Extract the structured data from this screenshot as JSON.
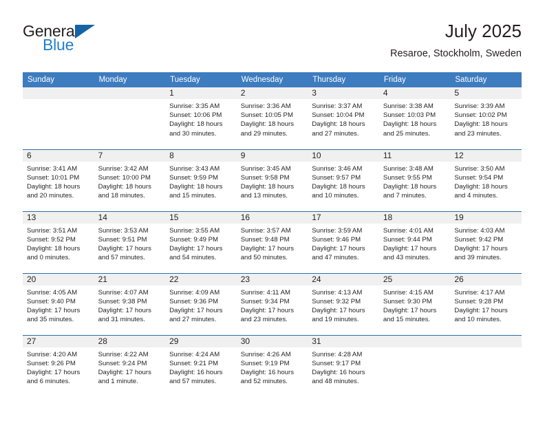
{
  "brand": {
    "name_part1": "General",
    "name_part2": "Blue",
    "logo_icon": "triangle-flag-icon"
  },
  "header": {
    "title": "July 2025",
    "location": "Resaroe, Stockholm, Sweden"
  },
  "colors": {
    "header_blue": "#3d7cbf",
    "separator_blue": "#2e6ca4",
    "daynum_band": "#f0f0f0",
    "brand_blue": "#1f7fd0",
    "logo_blue": "#1464a5",
    "text": "#231f20"
  },
  "weekday_headers": [
    "Sunday",
    "Monday",
    "Tuesday",
    "Wednesday",
    "Thursday",
    "Friday",
    "Saturday"
  ],
  "weeks": [
    [
      {
        "day": "",
        "sunrise": "",
        "sunset": "",
        "daylight1": "",
        "daylight2": ""
      },
      {
        "day": "",
        "sunrise": "",
        "sunset": "",
        "daylight1": "",
        "daylight2": ""
      },
      {
        "day": "1",
        "sunrise": "Sunrise: 3:35 AM",
        "sunset": "Sunset: 10:06 PM",
        "daylight1": "Daylight: 18 hours",
        "daylight2": "and 30 minutes."
      },
      {
        "day": "2",
        "sunrise": "Sunrise: 3:36 AM",
        "sunset": "Sunset: 10:05 PM",
        "daylight1": "Daylight: 18 hours",
        "daylight2": "and 29 minutes."
      },
      {
        "day": "3",
        "sunrise": "Sunrise: 3:37 AM",
        "sunset": "Sunset: 10:04 PM",
        "daylight1": "Daylight: 18 hours",
        "daylight2": "and 27 minutes."
      },
      {
        "day": "4",
        "sunrise": "Sunrise: 3:38 AM",
        "sunset": "Sunset: 10:03 PM",
        "daylight1": "Daylight: 18 hours",
        "daylight2": "and 25 minutes."
      },
      {
        "day": "5",
        "sunrise": "Sunrise: 3:39 AM",
        "sunset": "Sunset: 10:02 PM",
        "daylight1": "Daylight: 18 hours",
        "daylight2": "and 23 minutes."
      }
    ],
    [
      {
        "day": "6",
        "sunrise": "Sunrise: 3:41 AM",
        "sunset": "Sunset: 10:01 PM",
        "daylight1": "Daylight: 18 hours",
        "daylight2": "and 20 minutes."
      },
      {
        "day": "7",
        "sunrise": "Sunrise: 3:42 AM",
        "sunset": "Sunset: 10:00 PM",
        "daylight1": "Daylight: 18 hours",
        "daylight2": "and 18 minutes."
      },
      {
        "day": "8",
        "sunrise": "Sunrise: 3:43 AM",
        "sunset": "Sunset: 9:59 PM",
        "daylight1": "Daylight: 18 hours",
        "daylight2": "and 15 minutes."
      },
      {
        "day": "9",
        "sunrise": "Sunrise: 3:45 AM",
        "sunset": "Sunset: 9:58 PM",
        "daylight1": "Daylight: 18 hours",
        "daylight2": "and 13 minutes."
      },
      {
        "day": "10",
        "sunrise": "Sunrise: 3:46 AM",
        "sunset": "Sunset: 9:57 PM",
        "daylight1": "Daylight: 18 hours",
        "daylight2": "and 10 minutes."
      },
      {
        "day": "11",
        "sunrise": "Sunrise: 3:48 AM",
        "sunset": "Sunset: 9:55 PM",
        "daylight1": "Daylight: 18 hours",
        "daylight2": "and 7 minutes."
      },
      {
        "day": "12",
        "sunrise": "Sunrise: 3:50 AM",
        "sunset": "Sunset: 9:54 PM",
        "daylight1": "Daylight: 18 hours",
        "daylight2": "and 4 minutes."
      }
    ],
    [
      {
        "day": "13",
        "sunrise": "Sunrise: 3:51 AM",
        "sunset": "Sunset: 9:52 PM",
        "daylight1": "Daylight: 18 hours",
        "daylight2": "and 0 minutes."
      },
      {
        "day": "14",
        "sunrise": "Sunrise: 3:53 AM",
        "sunset": "Sunset: 9:51 PM",
        "daylight1": "Daylight: 17 hours",
        "daylight2": "and 57 minutes."
      },
      {
        "day": "15",
        "sunrise": "Sunrise: 3:55 AM",
        "sunset": "Sunset: 9:49 PM",
        "daylight1": "Daylight: 17 hours",
        "daylight2": "and 54 minutes."
      },
      {
        "day": "16",
        "sunrise": "Sunrise: 3:57 AM",
        "sunset": "Sunset: 9:48 PM",
        "daylight1": "Daylight: 17 hours",
        "daylight2": "and 50 minutes."
      },
      {
        "day": "17",
        "sunrise": "Sunrise: 3:59 AM",
        "sunset": "Sunset: 9:46 PM",
        "daylight1": "Daylight: 17 hours",
        "daylight2": "and 47 minutes."
      },
      {
        "day": "18",
        "sunrise": "Sunrise: 4:01 AM",
        "sunset": "Sunset: 9:44 PM",
        "daylight1": "Daylight: 17 hours",
        "daylight2": "and 43 minutes."
      },
      {
        "day": "19",
        "sunrise": "Sunrise: 4:03 AM",
        "sunset": "Sunset: 9:42 PM",
        "daylight1": "Daylight: 17 hours",
        "daylight2": "and 39 minutes."
      }
    ],
    [
      {
        "day": "20",
        "sunrise": "Sunrise: 4:05 AM",
        "sunset": "Sunset: 9:40 PM",
        "daylight1": "Daylight: 17 hours",
        "daylight2": "and 35 minutes."
      },
      {
        "day": "21",
        "sunrise": "Sunrise: 4:07 AM",
        "sunset": "Sunset: 9:38 PM",
        "daylight1": "Daylight: 17 hours",
        "daylight2": "and 31 minutes."
      },
      {
        "day": "22",
        "sunrise": "Sunrise: 4:09 AM",
        "sunset": "Sunset: 9:36 PM",
        "daylight1": "Daylight: 17 hours",
        "daylight2": "and 27 minutes."
      },
      {
        "day": "23",
        "sunrise": "Sunrise: 4:11 AM",
        "sunset": "Sunset: 9:34 PM",
        "daylight1": "Daylight: 17 hours",
        "daylight2": "and 23 minutes."
      },
      {
        "day": "24",
        "sunrise": "Sunrise: 4:13 AM",
        "sunset": "Sunset: 9:32 PM",
        "daylight1": "Daylight: 17 hours",
        "daylight2": "and 19 minutes."
      },
      {
        "day": "25",
        "sunrise": "Sunrise: 4:15 AM",
        "sunset": "Sunset: 9:30 PM",
        "daylight1": "Daylight: 17 hours",
        "daylight2": "and 15 minutes."
      },
      {
        "day": "26",
        "sunrise": "Sunrise: 4:17 AM",
        "sunset": "Sunset: 9:28 PM",
        "daylight1": "Daylight: 17 hours",
        "daylight2": "and 10 minutes."
      }
    ],
    [
      {
        "day": "27",
        "sunrise": "Sunrise: 4:20 AM",
        "sunset": "Sunset: 9:26 PM",
        "daylight1": "Daylight: 17 hours",
        "daylight2": "and 6 minutes."
      },
      {
        "day": "28",
        "sunrise": "Sunrise: 4:22 AM",
        "sunset": "Sunset: 9:24 PM",
        "daylight1": "Daylight: 17 hours",
        "daylight2": "and 1 minute."
      },
      {
        "day": "29",
        "sunrise": "Sunrise: 4:24 AM",
        "sunset": "Sunset: 9:21 PM",
        "daylight1": "Daylight: 16 hours",
        "daylight2": "and 57 minutes."
      },
      {
        "day": "30",
        "sunrise": "Sunrise: 4:26 AM",
        "sunset": "Sunset: 9:19 PM",
        "daylight1": "Daylight: 16 hours",
        "daylight2": "and 52 minutes."
      },
      {
        "day": "31",
        "sunrise": "Sunrise: 4:28 AM",
        "sunset": "Sunset: 9:17 PM",
        "daylight1": "Daylight: 16 hours",
        "daylight2": "and 48 minutes."
      },
      {
        "day": "",
        "sunrise": "",
        "sunset": "",
        "daylight1": "",
        "daylight2": ""
      },
      {
        "day": "",
        "sunrise": "",
        "sunset": "",
        "daylight1": "",
        "daylight2": ""
      }
    ]
  ]
}
